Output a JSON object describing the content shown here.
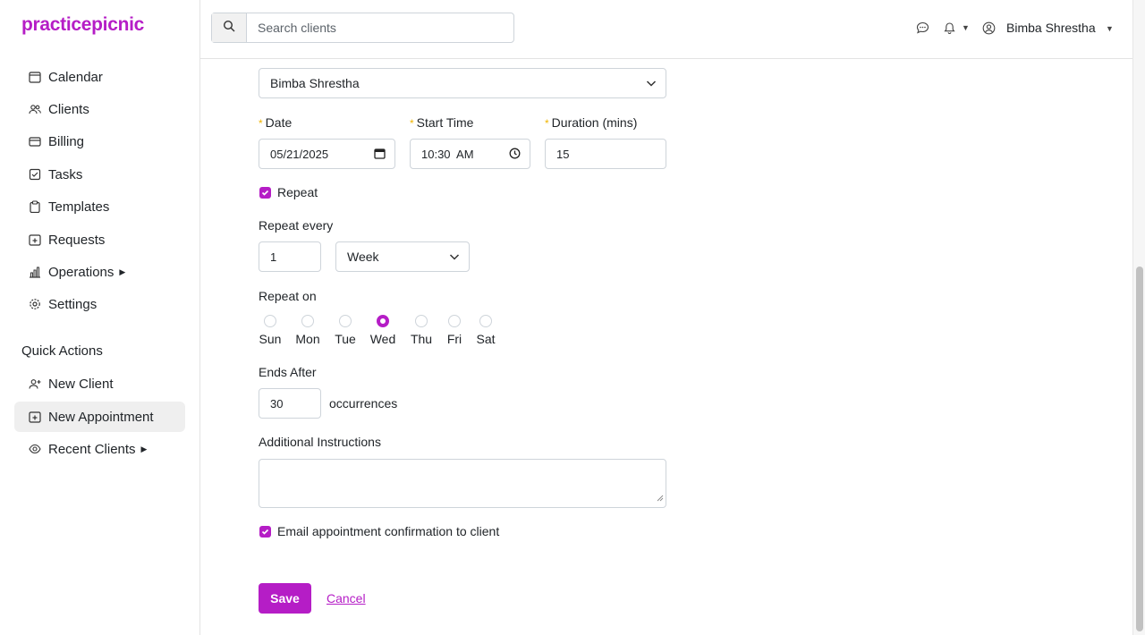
{
  "app": {
    "logo": "practicepicnic"
  },
  "sidebar": {
    "items": [
      {
        "label": "Calendar",
        "icon": "calendar-icon"
      },
      {
        "label": "Clients",
        "icon": "users-icon"
      },
      {
        "label": "Billing",
        "icon": "credit-card-icon"
      },
      {
        "label": "Tasks",
        "icon": "check-square-icon"
      },
      {
        "label": "Templates",
        "icon": "clipboard-icon"
      },
      {
        "label": "Requests",
        "icon": "calendar-plus-icon"
      },
      {
        "label": "Operations",
        "icon": "bar-chart-icon"
      },
      {
        "label": "Settings",
        "icon": "gear-icon"
      }
    ],
    "quick_actions_title": "Quick Actions",
    "quick_actions": [
      {
        "label": "New Client",
        "icon": "person-plus-icon"
      },
      {
        "label": "New Appointment",
        "icon": "calendar-plus-icon"
      },
      {
        "label": "Recent Clients",
        "icon": "eye-icon"
      }
    ]
  },
  "header": {
    "search_placeholder": "Search clients",
    "user_name": "Bimba Shrestha"
  },
  "form": {
    "client_value": "Bimba Shrestha",
    "date_label": "Date",
    "date_value": "05/21/2025",
    "start_time_label": "Start Time",
    "start_time_value": "10:30  AM",
    "duration_label": "Duration (mins)",
    "duration_value": "15",
    "repeat_label": "Repeat",
    "repeat_every_label": "Repeat every",
    "repeat_every_value": "1",
    "repeat_unit": "Week",
    "repeat_on_label": "Repeat on",
    "days": [
      "Sun",
      "Mon",
      "Tue",
      "Wed",
      "Thu",
      "Fri",
      "Sat"
    ],
    "selected_day": "Wed",
    "ends_after_label": "Ends After",
    "ends_after_value": "30",
    "occurrences_label": "occurrences",
    "instructions_label": "Additional Instructions",
    "email_confirm_label": "Email appointment confirmation to client",
    "save_label": "Save",
    "cancel_label": "Cancel"
  },
  "colors": {
    "accent": "#b51dc6",
    "required": "#f0b400"
  }
}
